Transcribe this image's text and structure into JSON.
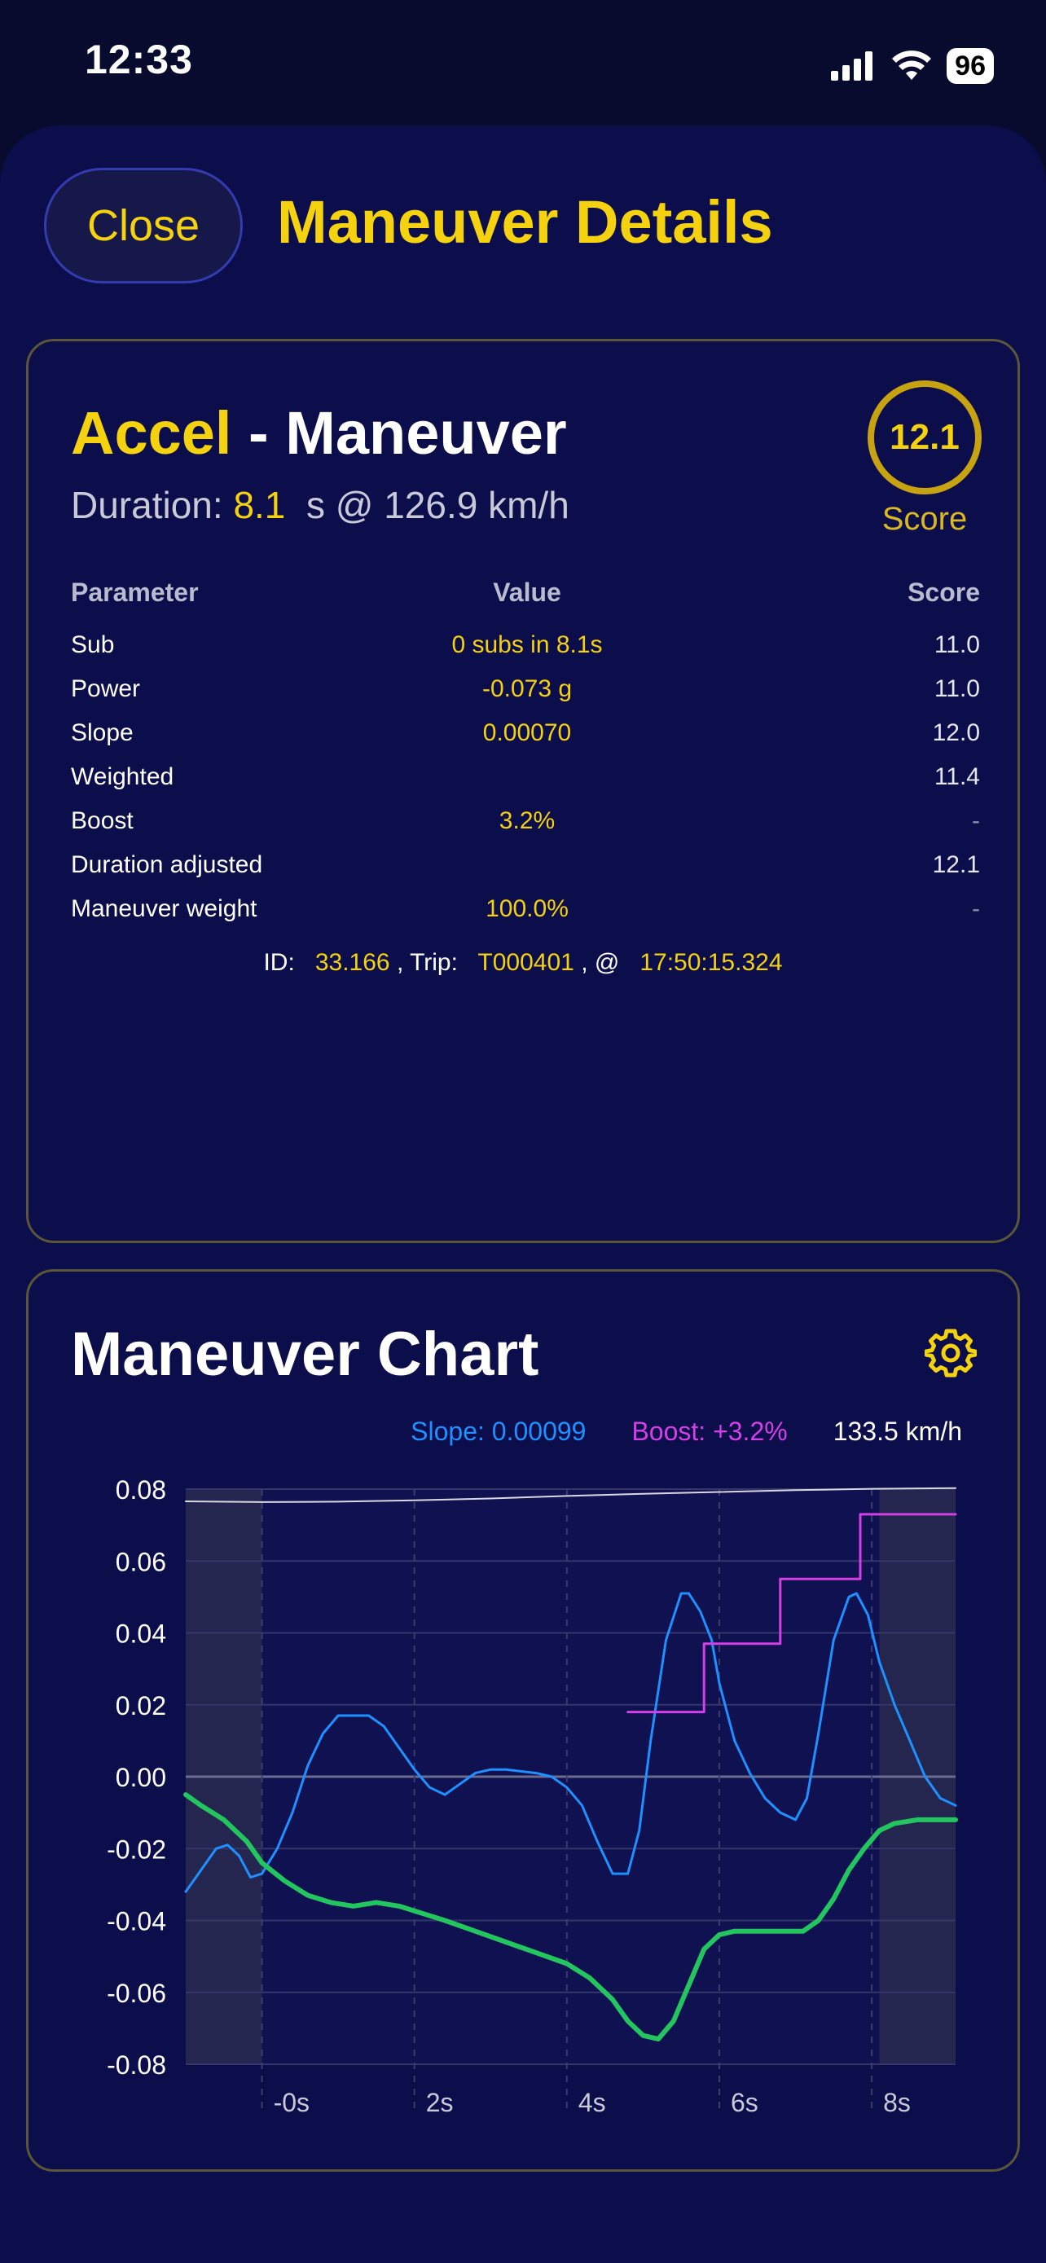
{
  "status": {
    "time": "12:33",
    "battery": "96"
  },
  "header": {
    "close_label": "Close",
    "title": "Maneuver Details"
  },
  "maneuver": {
    "type": "Accel",
    "suffix": " - Maneuver",
    "duration_label": "Duration: ",
    "duration_value": "8.1",
    "duration_rest": "  s @ 126.9 km/h",
    "score": "12.1",
    "score_label": "Score"
  },
  "params": {
    "headers": [
      "Parameter",
      "Value",
      "Score"
    ],
    "rows": [
      {
        "name": "Sub",
        "value": "0 subs in 8.1s",
        "score": "11.0"
      },
      {
        "name": "Power",
        "value": "-0.073 g",
        "score": "11.0"
      },
      {
        "name": "Slope",
        "value": "0.00070",
        "score": "12.0"
      },
      {
        "name": "Weighted",
        "value": "",
        "score": "11.4"
      },
      {
        "name": "Boost",
        "value": "3.2%",
        "score": "-"
      },
      {
        "name": "Duration adjusted",
        "value": "",
        "score": "12.1"
      },
      {
        "name": "Maneuver weight",
        "value": "100.0%",
        "score": "-"
      }
    ]
  },
  "id_line": {
    "id_label": "ID:",
    "id": "33.166",
    "trip_label": ", Trip:",
    "trip": "T000401",
    "at_label": ", @",
    "time": "17:50:15.324"
  },
  "chart": {
    "title": "Maneuver Chart",
    "legend": {
      "slope": "Slope: 0.00099",
      "boost": "Boost: +3.2%",
      "speed": "133.5 km/h"
    },
    "colors": {
      "slope": "#1e90ff",
      "boost": "#d43fe6",
      "accel": "#22c55e",
      "speed": "#d8d8e0"
    }
  },
  "chart_data": {
    "type": "line",
    "xlim": [
      -1,
      9.1
    ],
    "ylim": [
      -0.08,
      0.08
    ],
    "x_ticks": [
      0,
      2,
      4,
      6,
      8
    ],
    "x_tick_labels": [
      "-0s",
      "2s",
      "4s",
      "6s",
      "8s"
    ],
    "y_ticks": [
      -0.08,
      -0.06,
      -0.04,
      -0.02,
      0.0,
      0.02,
      0.04,
      0.06,
      0.08
    ],
    "y_tick_labels": [
      "-0.08",
      "-0.06",
      "-0.04",
      "-0.02",
      "0.00",
      "0.02",
      "0.04",
      "0.06",
      "0.08"
    ],
    "shaded_ranges": [
      [
        -1,
        0
      ],
      [
        8.1,
        9.1
      ]
    ],
    "series": [
      {
        "name": "Slope: 0.00099",
        "points": [
          [
            -1,
            -0.032
          ],
          [
            -0.8,
            -0.026
          ],
          [
            -0.6,
            -0.02
          ],
          [
            -0.45,
            -0.019
          ],
          [
            -0.3,
            -0.022
          ],
          [
            -0.15,
            -0.028
          ],
          [
            0,
            -0.027
          ],
          [
            0.2,
            -0.02
          ],
          [
            0.4,
            -0.01
          ],
          [
            0.6,
            0.003
          ],
          [
            0.8,
            0.012
          ],
          [
            1.0,
            0.017
          ],
          [
            1.4,
            0.017
          ],
          [
            1.6,
            0.014
          ],
          [
            1.8,
            0.008
          ],
          [
            2.0,
            0.002
          ],
          [
            2.2,
            -0.003
          ],
          [
            2.4,
            -0.005
          ],
          [
            2.6,
            -0.002
          ],
          [
            2.8,
            0.001
          ],
          [
            3.0,
            0.002
          ],
          [
            3.2,
            0.002
          ],
          [
            3.6,
            0.001
          ],
          [
            3.8,
            0.0
          ],
          [
            4.0,
            -0.003
          ],
          [
            4.2,
            -0.008
          ],
          [
            4.4,
            -0.018
          ],
          [
            4.6,
            -0.027
          ],
          [
            4.8,
            -0.027
          ],
          [
            4.95,
            -0.015
          ],
          [
            5.1,
            0.01
          ],
          [
            5.3,
            0.038
          ],
          [
            5.5,
            0.051
          ],
          [
            5.6,
            0.051
          ],
          [
            5.75,
            0.046
          ],
          [
            5.9,
            0.038
          ],
          [
            6.0,
            0.026
          ],
          [
            6.2,
            0.01
          ],
          [
            6.4,
            0.001
          ],
          [
            6.6,
            -0.006
          ],
          [
            6.8,
            -0.01
          ],
          [
            7.0,
            -0.012
          ],
          [
            7.15,
            -0.006
          ],
          [
            7.3,
            0.012
          ],
          [
            7.5,
            0.038
          ],
          [
            7.7,
            0.05
          ],
          [
            7.8,
            0.051
          ],
          [
            7.95,
            0.045
          ],
          [
            8.1,
            0.032
          ],
          [
            8.3,
            0.02
          ],
          [
            8.5,
            0.01
          ],
          [
            8.7,
            0.0
          ],
          [
            8.9,
            -0.006
          ],
          [
            9.1,
            -0.008
          ]
        ]
      },
      {
        "name": "Boost: +3.2%",
        "points": [
          [
            4.8,
            0.018
          ],
          [
            5.8,
            0.018
          ],
          [
            5.8,
            0.037
          ],
          [
            6.8,
            0.037
          ],
          [
            6.8,
            0.055
          ],
          [
            7.85,
            0.055
          ],
          [
            7.85,
            0.073
          ],
          [
            9.1,
            0.073
          ]
        ]
      },
      {
        "name": "accel",
        "points": [
          [
            -1,
            -0.005
          ],
          [
            -0.8,
            -0.008
          ],
          [
            -0.5,
            -0.012
          ],
          [
            -0.2,
            -0.018
          ],
          [
            0,
            -0.024
          ],
          [
            0.3,
            -0.029
          ],
          [
            0.6,
            -0.033
          ],
          [
            0.9,
            -0.035
          ],
          [
            1.2,
            -0.036
          ],
          [
            1.5,
            -0.035
          ],
          [
            1.8,
            -0.036
          ],
          [
            2.1,
            -0.038
          ],
          [
            2.4,
            -0.04
          ],
          [
            2.8,
            -0.043
          ],
          [
            3.2,
            -0.046
          ],
          [
            3.6,
            -0.049
          ],
          [
            4.0,
            -0.052
          ],
          [
            4.3,
            -0.056
          ],
          [
            4.6,
            -0.062
          ],
          [
            4.8,
            -0.068
          ],
          [
            5.0,
            -0.072
          ],
          [
            5.2,
            -0.073
          ],
          [
            5.4,
            -0.068
          ],
          [
            5.6,
            -0.058
          ],
          [
            5.8,
            -0.048
          ],
          [
            6.0,
            -0.044
          ],
          [
            6.2,
            -0.043
          ],
          [
            6.5,
            -0.043
          ],
          [
            6.8,
            -0.043
          ],
          [
            7.1,
            -0.043
          ],
          [
            7.3,
            -0.04
          ],
          [
            7.5,
            -0.034
          ],
          [
            7.7,
            -0.026
          ],
          [
            7.9,
            -0.02
          ],
          [
            8.1,
            -0.015
          ],
          [
            8.3,
            -0.013
          ],
          [
            8.6,
            -0.012
          ],
          [
            9.1,
            -0.012
          ]
        ]
      },
      {
        "name": "133.5 km/h",
        "points": [
          [
            -1,
            0.0766
          ],
          [
            0,
            0.0764
          ],
          [
            1,
            0.0765
          ],
          [
            2,
            0.0769
          ],
          [
            3,
            0.0774
          ],
          [
            4,
            0.0781
          ],
          [
            5,
            0.0787
          ],
          [
            6,
            0.0792
          ],
          [
            7,
            0.0797
          ],
          [
            8,
            0.0801
          ],
          [
            9.1,
            0.0803
          ]
        ]
      }
    ]
  }
}
